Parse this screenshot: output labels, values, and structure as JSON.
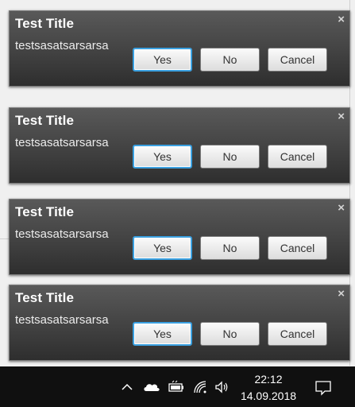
{
  "notifications": [
    {
      "title": "Test Title",
      "message": "testsasatsarsarsa",
      "close": "×",
      "yes": "Yes",
      "no": "No",
      "cancel": "Cancel"
    },
    {
      "title": "Test Title",
      "message": "testsasatsarsarsa",
      "close": "×",
      "yes": "Yes",
      "no": "No",
      "cancel": "Cancel"
    },
    {
      "title": "Test Title",
      "message": "testsasatsarsarsa",
      "close": "×",
      "yes": "Yes",
      "no": "No",
      "cancel": "Cancel"
    },
    {
      "title": "Test Title",
      "message": "testsasatsarsarsa",
      "close": "×",
      "yes": "Yes",
      "no": "No",
      "cancel": "Cancel"
    }
  ],
  "taskbar": {
    "time": "22:12",
    "date": "14.09.2018",
    "icons": [
      "chevron-up-icon",
      "onedrive-cloud-icon",
      "battery-icon",
      "wifi-icon",
      "volume-icon",
      "action-center-icon"
    ]
  },
  "colors": {
    "focus_ring": "#3aa0e0",
    "taskbar_bg": "#101010",
    "notification_bg": "#424242"
  }
}
